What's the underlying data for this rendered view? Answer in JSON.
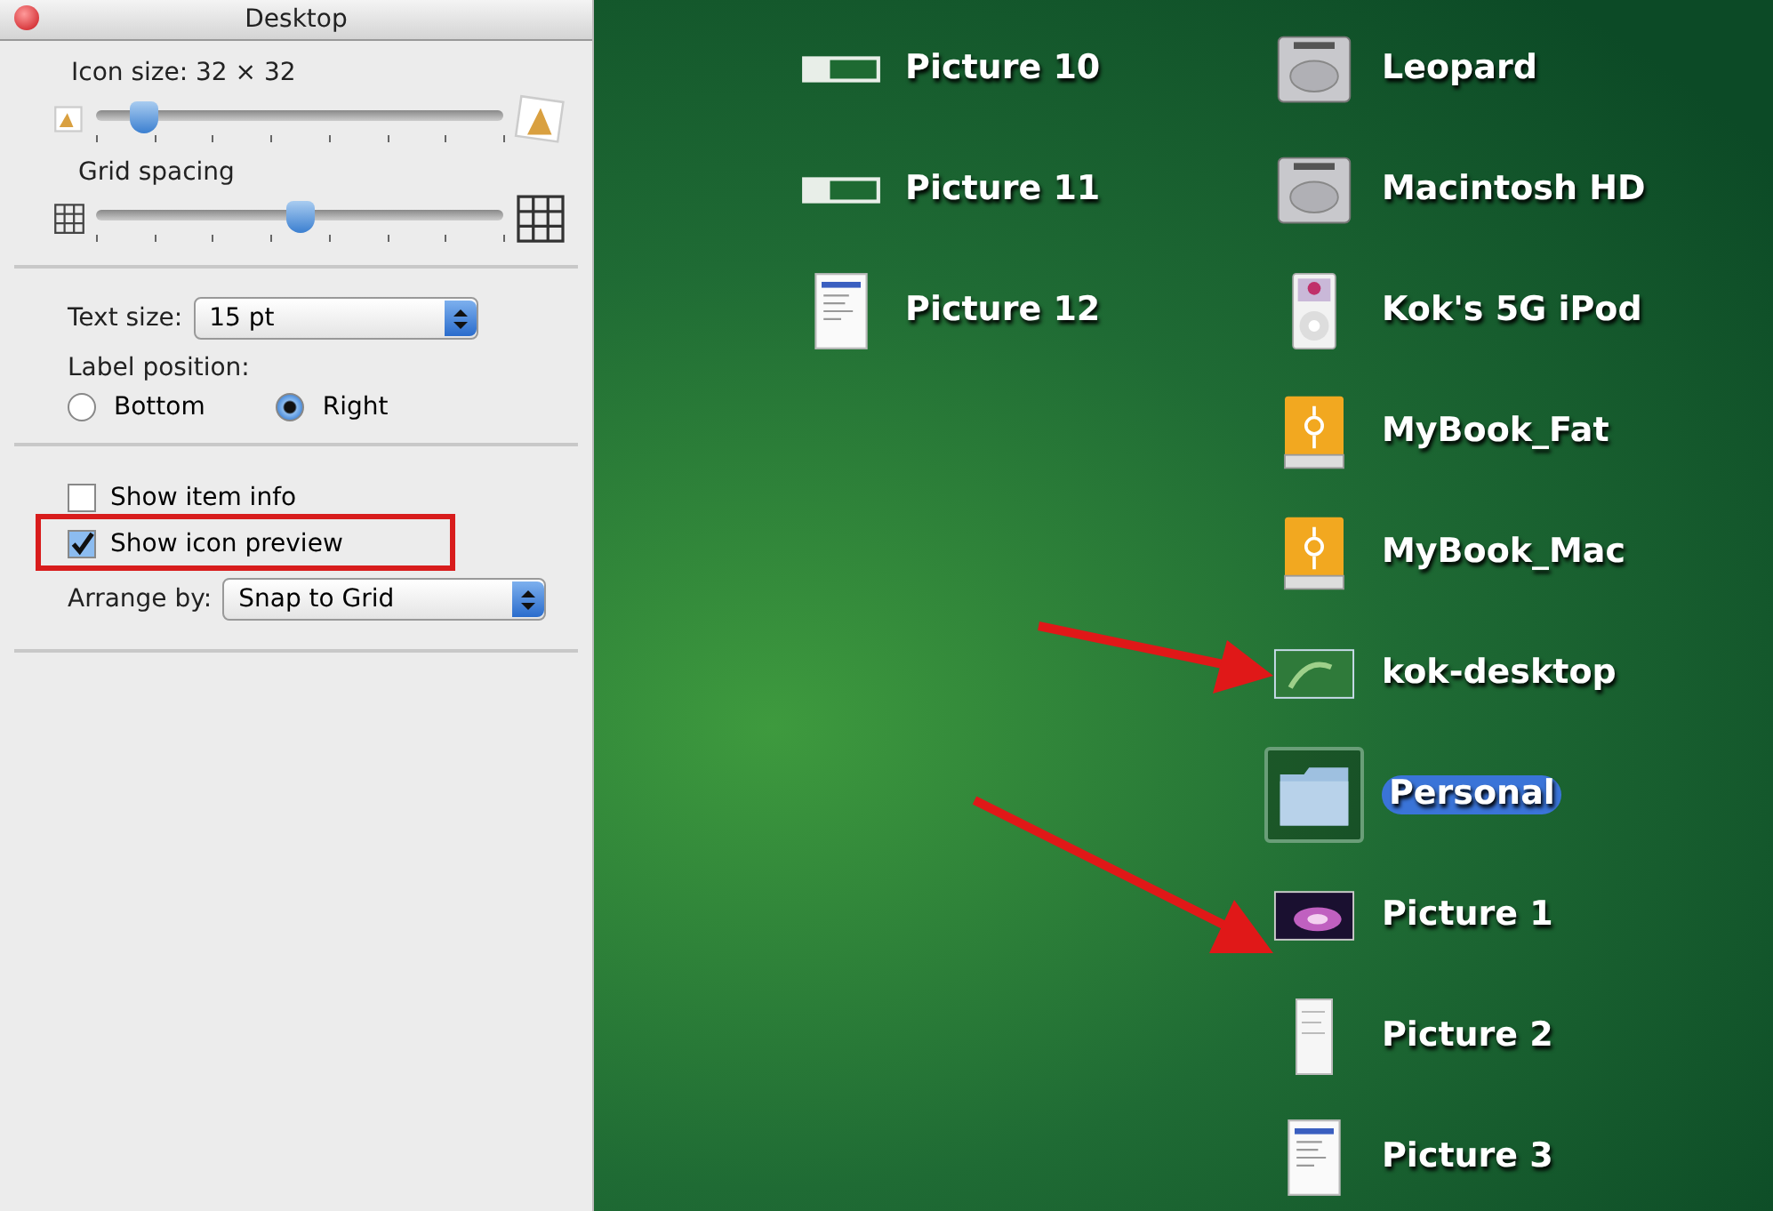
{
  "window": {
    "title": "Desktop"
  },
  "sliders": [
    {
      "label": "Icon size: 32 × 32",
      "level": 0.12,
      "kind": "icon"
    },
    {
      "label": "Grid spacing",
      "level": 0.5,
      "kind": "grid"
    }
  ],
  "text_size": {
    "label": "Text size:",
    "value": "15 pt"
  },
  "label_position": {
    "label": "Label position:",
    "options": [
      {
        "label": "Bottom",
        "selected": false
      },
      {
        "label": "Right",
        "selected": true
      }
    ]
  },
  "checkboxes": [
    {
      "label": "Show item info",
      "checked": false,
      "highlighted": false
    },
    {
      "label": "Show icon preview",
      "checked": true,
      "highlighted": true
    }
  ],
  "arrange_by": {
    "label": "Arrange by:",
    "value": "Snap to Grid"
  },
  "desktop_columns": [
    [
      {
        "name": "Picture 10",
        "kind": "strip",
        "selected": false
      },
      {
        "name": "Picture 11",
        "kind": "strip",
        "selected": false
      },
      {
        "name": "Picture 12",
        "kind": "document",
        "selected": false
      }
    ],
    [
      {
        "name": "Leopard",
        "kind": "disk",
        "selected": false
      },
      {
        "name": "Macintosh HD",
        "kind": "disk",
        "selected": false
      },
      {
        "name": "Kok's 5G iPod",
        "kind": "ipod",
        "selected": false
      },
      {
        "name": "MyBook_Fat",
        "kind": "drive",
        "selected": false
      },
      {
        "name": "MyBook_Mac",
        "kind": "drive",
        "selected": false
      },
      {
        "name": "kok-desktop",
        "kind": "greenimage",
        "selected": false
      },
      {
        "name": "Personal",
        "kind": "folder",
        "selected": true
      },
      {
        "name": "Picture 1",
        "kind": "space",
        "selected": false
      },
      {
        "name": "Picture 2",
        "kind": "page",
        "selected": false
      },
      {
        "name": "Picture 3",
        "kind": "document",
        "selected": false
      }
    ]
  ]
}
